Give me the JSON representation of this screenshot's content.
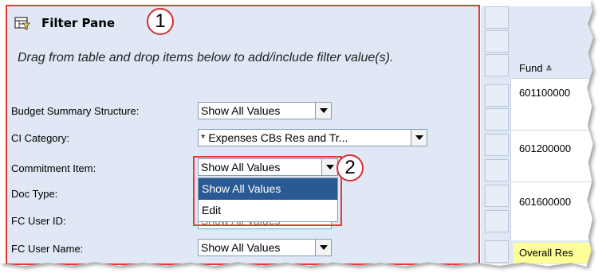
{
  "pane": {
    "title": "Filter Pane",
    "instruction": "Drag from table and drop items below to add/include filter value(s)."
  },
  "filters": [
    {
      "label": "Budget Summary Structure:",
      "value": "Show All Values"
    },
    {
      "label": "CI Category:",
      "value": "* Expenses CBs Res and Tr..."
    },
    {
      "label": "Commitment Item:",
      "value": "Show All Values"
    },
    {
      "label": "Doc Type:",
      "value": ""
    },
    {
      "label": "FC User ID:",
      "value": "Show All Values"
    },
    {
      "label": "FC User Name:",
      "value": "Show All Values"
    }
  ],
  "dropdown": {
    "options": [
      "Show All Values",
      "Edit"
    ],
    "selected_index": 0
  },
  "callouts": [
    "1",
    "2"
  ],
  "table": {
    "header": "Fund",
    "rows": [
      "601100000",
      "601200000",
      "601600000"
    ],
    "footer": "Overall Res"
  },
  "colors": {
    "pane_bg": "#dfe8f4",
    "highlight": "#e53935",
    "selected": "#2a5a93",
    "result_row": "#ffff99"
  }
}
